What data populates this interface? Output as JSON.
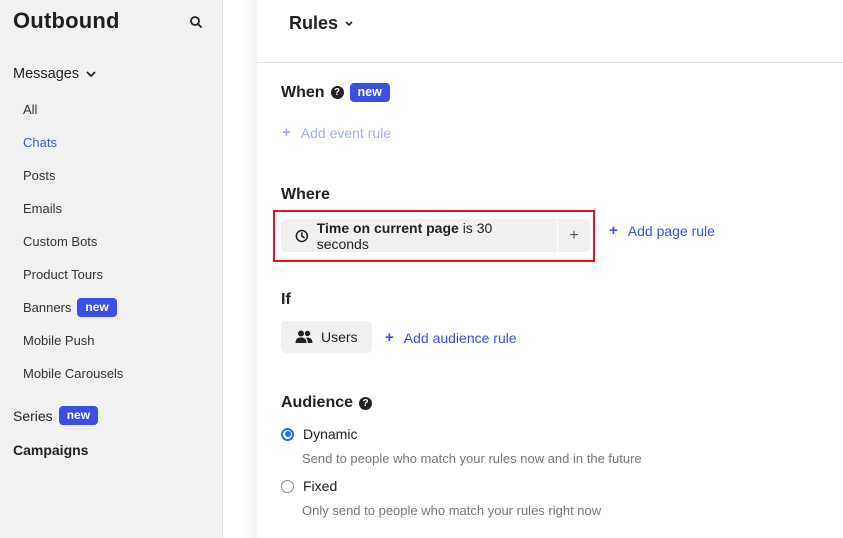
{
  "sidebar": {
    "title": "Outbound",
    "messages_label": "Messages",
    "items": [
      {
        "label": "All"
      },
      {
        "label": "Chats",
        "active": true
      },
      {
        "label": "Posts"
      },
      {
        "label": "Emails"
      },
      {
        "label": "Custom Bots"
      },
      {
        "label": "Product Tours"
      },
      {
        "label": "Banners",
        "badge": "new"
      },
      {
        "label": "Mobile Push"
      },
      {
        "label": "Mobile Carousels"
      }
    ],
    "series_label": "Series",
    "series_badge": "new",
    "campaigns_label": "Campaigns"
  },
  "header": {
    "title": "Rules"
  },
  "when": {
    "label": "When",
    "badge": "new",
    "add_label": "Add event rule"
  },
  "where": {
    "label": "Where",
    "rule": {
      "attribute": "Time on current page",
      "condition": "is 30 seconds"
    },
    "add_label": "Add page rule"
  },
  "if": {
    "label": "If",
    "chip_label": "Users",
    "add_label": "Add audience rule"
  },
  "audience": {
    "label": "Audience",
    "options": [
      {
        "label": "Dynamic",
        "description": "Send to people who match your rules now and in the future",
        "selected": true
      },
      {
        "label": "Fixed",
        "description": "Only send to people who match your rules right now",
        "selected": false
      }
    ]
  },
  "colors": {
    "accent": "#3b4fe6",
    "highlight": "#e8101a",
    "radio": "#1a73e8"
  }
}
